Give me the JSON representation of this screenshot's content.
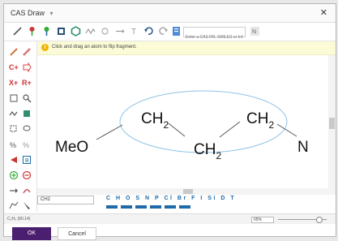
{
  "window": {
    "tab_title": "CAS Draw"
  },
  "toolbar": {
    "search_placeholder": "Enter a CAS RN, SMILES or InChI"
  },
  "hint": {
    "message": "Click and drag an atom to flip fragment."
  },
  "left_tools": {
    "c_plus": "C+",
    "x_plus": "X+",
    "r_plus": "R+"
  },
  "molecule": {
    "meo": "MeO",
    "ch2_a": "CH",
    "ch2_b": "CH",
    "ch2_c": "CH",
    "sub_2": "2",
    "n": "N"
  },
  "bottom": {
    "formula": "CH2",
    "elements": "C H O S N P Cl Br F I Si D T"
  },
  "status": {
    "formula": "C₂H₅ (60.14)",
    "zoom": "65%"
  },
  "footer": {
    "ok_label": "OK",
    "cancel_label": "Cancel"
  },
  "colors": {
    "accent": "#4b1f70",
    "element_blue": "#1f6aa8",
    "highlight": "#8fc3e5"
  }
}
